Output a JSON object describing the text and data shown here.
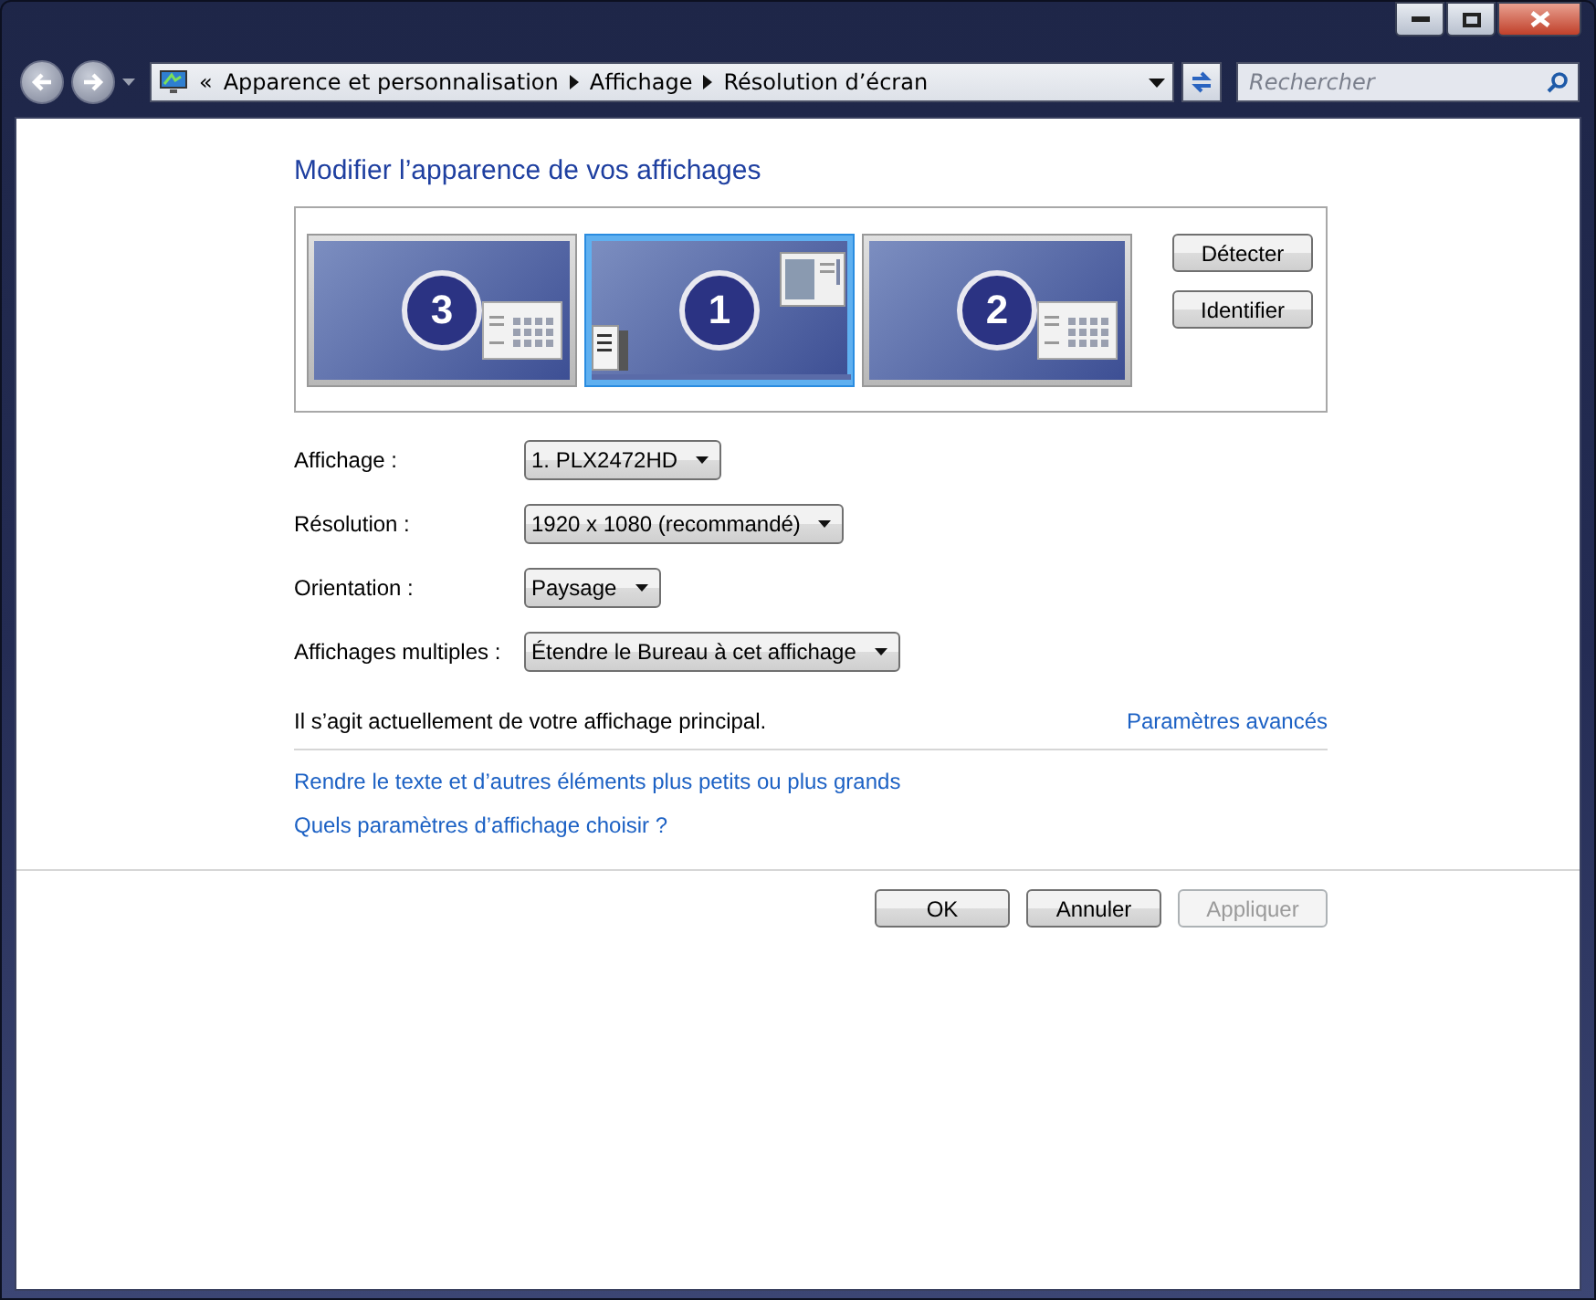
{
  "window": {
    "controls": [
      {
        "kind": "minimize"
      },
      {
        "kind": "maximize"
      },
      {
        "kind": "close"
      }
    ]
  },
  "address_bar": {
    "overflow": "«",
    "crumbs": [
      "Apparence et personnalisation",
      "Affichage",
      "Résolution d’écran"
    ]
  },
  "search": {
    "placeholder": "Rechercher"
  },
  "heading": "Modifier l’apparence de vos affichages",
  "monitors": [
    {
      "number": "3",
      "selected": false,
      "kind": "side"
    },
    {
      "number": "1",
      "selected": true,
      "kind": "main"
    },
    {
      "number": "2",
      "selected": false,
      "kind": "side"
    }
  ],
  "monitor_buttons": [
    "Détecter",
    "Identifier"
  ],
  "settings": [
    {
      "label": "Affichage :",
      "value": "1. PLX2472HD"
    },
    {
      "label": "Résolution :",
      "value": "1920 x 1080 (recommandé)"
    },
    {
      "label": "Orientation :",
      "value": "Paysage"
    },
    {
      "label": "Affichages multiples :",
      "value": "Étendre le Bureau à cet affichage"
    }
  ],
  "status_text": "Il s’agit actuellement de votre affichage principal.",
  "advanced_link": "Paramètres avancés",
  "links": [
    "Rendre le texte et d’autres éléments plus petits ou plus grands",
    "Quels paramètres d’affichage choisir ?"
  ],
  "buttons": [
    {
      "label": "OK",
      "disabled": false
    },
    {
      "label": "Annuler",
      "disabled": false
    },
    {
      "label": "Appliquer",
      "disabled": true
    }
  ]
}
